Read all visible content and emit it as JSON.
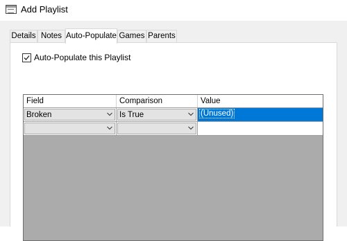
{
  "window": {
    "title": "Add Playlist",
    "icon": "window-icon"
  },
  "tabs": [
    {
      "label": "Details",
      "active": false
    },
    {
      "label": "Notes",
      "active": false
    },
    {
      "label": "Auto-Populate",
      "active": true
    },
    {
      "label": "Games",
      "active": false
    },
    {
      "label": "Parents",
      "active": false
    }
  ],
  "auto_populate": {
    "checkbox_label": "Auto-Populate this Playlist",
    "checked": true
  },
  "grid": {
    "columns": [
      "Field",
      "Comparison",
      "Value"
    ],
    "rows": [
      {
        "field": "Broken",
        "comparison": "Is True",
        "value": "(Unused)",
        "selected": true
      },
      {
        "field": "",
        "comparison": "",
        "value": "",
        "selected": false
      }
    ]
  },
  "colors": {
    "selection": "#0078d7",
    "grid_background": "#ababab",
    "window_background": "#f0f0f0"
  }
}
